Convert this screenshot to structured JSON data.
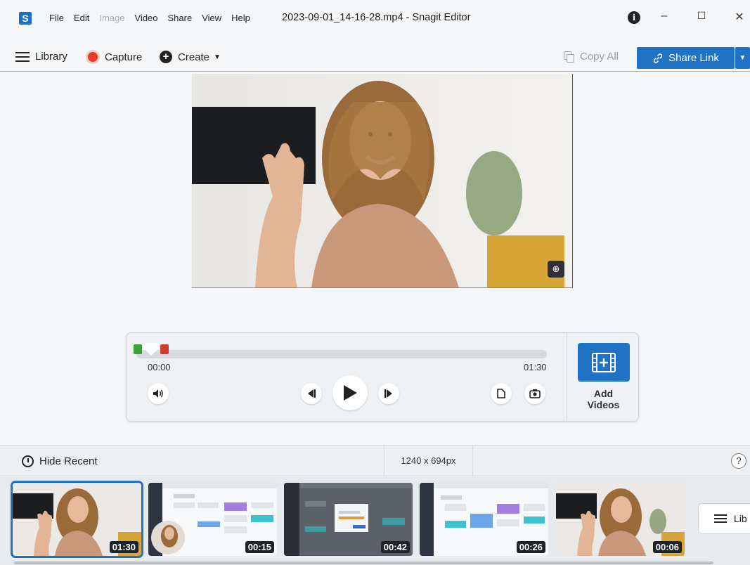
{
  "titlebar": {
    "logo_letter": "S",
    "menu": [
      "File",
      "Edit",
      "Image",
      "Video",
      "Share",
      "View",
      "Help"
    ],
    "menu_disabled": [
      "Image"
    ],
    "document_title": "2023-09-01_14-16-28.mp4 - Snagit Editor",
    "window_controls": {
      "minimize": "–",
      "maximize": "☐",
      "close": "✕"
    },
    "info_icon": "info-icon"
  },
  "toolbar": {
    "library_label": "Library",
    "capture_label": "Capture",
    "create_label": "Create",
    "copy_all_label": "Copy All",
    "share_link_label": "Share Link"
  },
  "player": {
    "time_start": "00:00",
    "time_end": "01:30",
    "add_videos_label_1": "Add",
    "add_videos_label_2": "Videos",
    "icons": [
      "volume-icon",
      "step-back-icon",
      "play-icon",
      "step-forward-icon",
      "save-frame-icon",
      "camera-icon"
    ]
  },
  "status": {
    "hide_recent_label": "Hide Recent",
    "dimensions": "1240 x 694px",
    "help": "?"
  },
  "recent": {
    "items": [
      {
        "duration": "01:30",
        "kind": "webcam-video",
        "selected": true
      },
      {
        "duration": "00:15",
        "kind": "screen-recording-with-webcam",
        "selected": false
      },
      {
        "duration": "00:42",
        "kind": "screen-recording-dark",
        "selected": false
      },
      {
        "duration": "00:26",
        "kind": "screen-recording",
        "selected": false
      },
      {
        "duration": "00:06",
        "kind": "webcam-video",
        "selected": false
      }
    ],
    "library_button_label": "Lib"
  },
  "colors": {
    "accent": "#1f72c4",
    "record": "#ea3a2c",
    "trim_start": "#3aa03a",
    "trim_end": "#d23b34"
  }
}
